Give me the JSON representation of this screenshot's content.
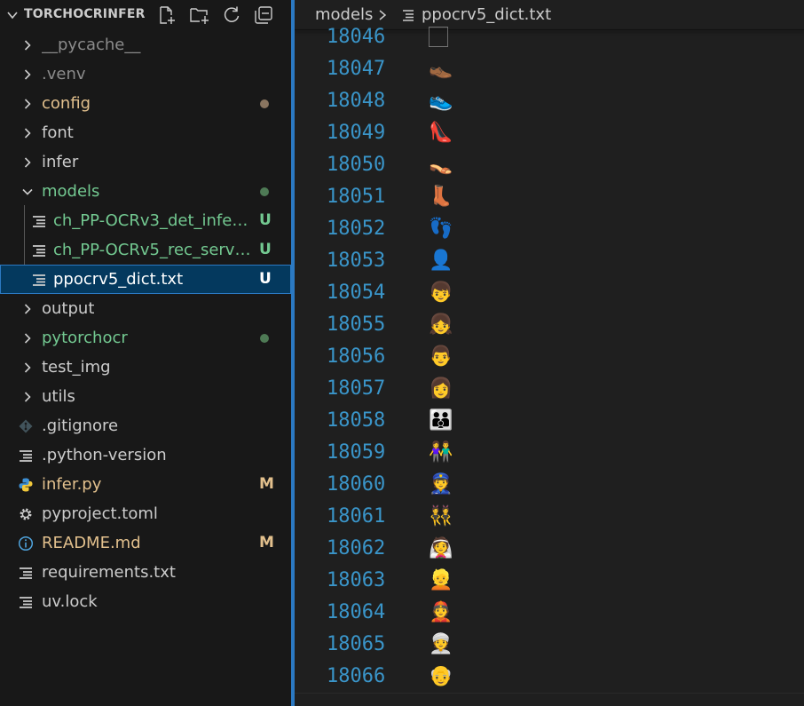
{
  "explorer": {
    "title": "TORCHOCRINFER",
    "actions": [
      {
        "name": "new-file-icon"
      },
      {
        "name": "new-folder-icon"
      },
      {
        "name": "refresh-icon"
      },
      {
        "name": "collapse-all-icon"
      }
    ],
    "items": [
      {
        "label": "__pycache__",
        "kind": "folder",
        "expanded": false,
        "depth": 0,
        "color": "#8b8b8b"
      },
      {
        "label": ".venv",
        "kind": "folder",
        "expanded": false,
        "depth": 0,
        "color": "#8b8b8b"
      },
      {
        "label": "config",
        "kind": "folder",
        "expanded": false,
        "depth": 0,
        "color": "#e2c08d",
        "dot": "#8a7560"
      },
      {
        "label": "font",
        "kind": "folder",
        "expanded": false,
        "depth": 0,
        "color": "#cccccc"
      },
      {
        "label": "infer",
        "kind": "folder",
        "expanded": false,
        "depth": 0,
        "color": "#cccccc"
      },
      {
        "label": "models",
        "kind": "folder",
        "expanded": true,
        "depth": 0,
        "color": "#73c991",
        "dot": "#4e7a55"
      },
      {
        "label": "ch_PP-OCRv3_det_infer....",
        "kind": "file",
        "icon": "lines-icon",
        "depth": 1,
        "color": "#73c991",
        "badge": "U",
        "badgeColor": "#73c991"
      },
      {
        "label": "ch_PP-OCRv5_rec_server...",
        "kind": "file",
        "icon": "lines-icon",
        "depth": 1,
        "color": "#73c991",
        "badge": "U",
        "badgeColor": "#73c991"
      },
      {
        "label": "ppocrv5_dict.txt",
        "kind": "file",
        "icon": "lines-icon",
        "depth": 1,
        "color": "#ffffff",
        "badge": "U",
        "badgeColor": "#ffffff",
        "selected": true
      },
      {
        "label": "output",
        "kind": "folder",
        "expanded": false,
        "depth": 0,
        "color": "#cccccc"
      },
      {
        "label": "pytorchocr",
        "kind": "folder",
        "expanded": false,
        "depth": 0,
        "color": "#73c991",
        "dot": "#4e7a55"
      },
      {
        "label": "test_img",
        "kind": "folder",
        "expanded": false,
        "depth": 0,
        "color": "#cccccc"
      },
      {
        "label": "utils",
        "kind": "folder",
        "expanded": false,
        "depth": 0,
        "color": "#cccccc"
      },
      {
        "label": ".gitignore",
        "kind": "file",
        "icon": "git-icon",
        "depth": 0,
        "color": "#cccccc"
      },
      {
        "label": ".python-version",
        "kind": "file",
        "icon": "lines-icon",
        "depth": 0,
        "color": "#cccccc"
      },
      {
        "label": "infer.py",
        "kind": "file",
        "icon": "python-icon",
        "depth": 0,
        "color": "#e2c08d",
        "badge": "M",
        "badgeColor": "#e2c08d"
      },
      {
        "label": "pyproject.toml",
        "kind": "file",
        "icon": "gear-icon",
        "depth": 0,
        "color": "#cccccc"
      },
      {
        "label": "README.md",
        "kind": "file",
        "icon": "info-icon",
        "depth": 0,
        "color": "#e2c08d",
        "badge": "M",
        "badgeColor": "#e2c08d"
      },
      {
        "label": "requirements.txt",
        "kind": "file",
        "icon": "lines-icon",
        "depth": 0,
        "color": "#cccccc"
      },
      {
        "label": "uv.lock",
        "kind": "file",
        "icon": "lines-icon",
        "depth": 0,
        "color": "#cccccc"
      }
    ]
  },
  "breadcrumb": {
    "folder": "models",
    "file": "ppocrv5_dict.txt"
  },
  "editor": {
    "lines": [
      {
        "number": "18046",
        "content": "🏻"
      },
      {
        "number": "18047",
        "content": "👞"
      },
      {
        "number": "18048",
        "content": "👟"
      },
      {
        "number": "18049",
        "content": "👠"
      },
      {
        "number": "18050",
        "content": "👡"
      },
      {
        "number": "18051",
        "content": "👢"
      },
      {
        "number": "18052",
        "content": "👣"
      },
      {
        "number": "18053",
        "content": "👤"
      },
      {
        "number": "18054",
        "content": "👦"
      },
      {
        "number": "18055",
        "content": "👧"
      },
      {
        "number": "18056",
        "content": "👨"
      },
      {
        "number": "18057",
        "content": "👩"
      },
      {
        "number": "18058",
        "content": "👪"
      },
      {
        "number": "18059",
        "content": "👫"
      },
      {
        "number": "18060",
        "content": "👮"
      },
      {
        "number": "18061",
        "content": "👯"
      },
      {
        "number": "18062",
        "content": "👰"
      },
      {
        "number": "18063",
        "content": "👱"
      },
      {
        "number": "18064",
        "content": "👲"
      },
      {
        "number": "18065",
        "content": "👳"
      },
      {
        "number": "18066",
        "content": "👴"
      }
    ]
  },
  "colors": {
    "accent": "#2b79c2",
    "selected_bg": "#04395e",
    "line_number": "#3a95c9",
    "untracked": "#73c991",
    "modified": "#e2c08d"
  }
}
